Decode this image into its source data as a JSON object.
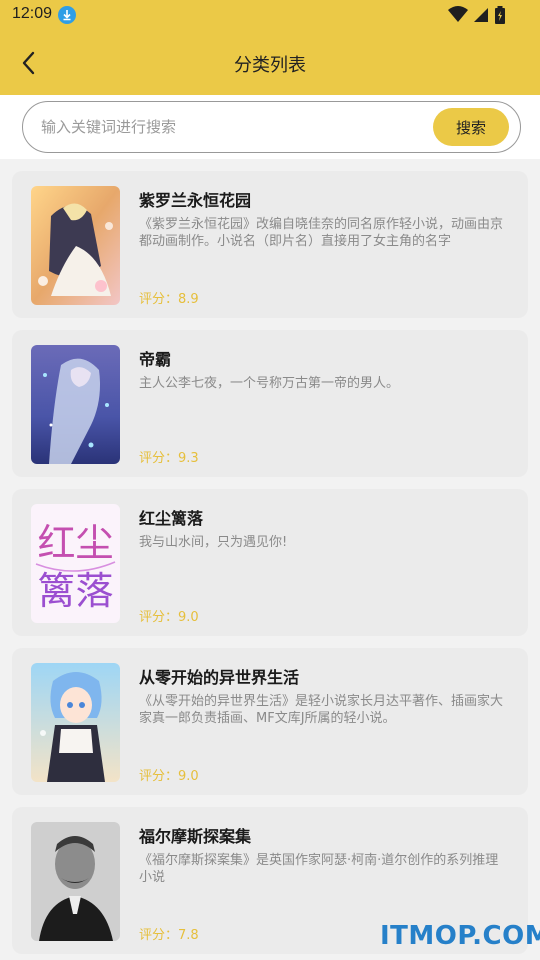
{
  "status_bar": {
    "time": "12:09",
    "icons": [
      "download-icon",
      "wifi-icon",
      "signal-icon",
      "battery-icon"
    ]
  },
  "header": {
    "back_icon": "chevron-left-icon",
    "title": "分类列表",
    "background": "#ebc947"
  },
  "search": {
    "placeholder": "输入关键词进行搜索",
    "value": "",
    "button_label": "搜索"
  },
  "books": [
    {
      "title": "紫罗兰永恒花园",
      "description": "《紫罗兰永恒花园》改编自晓佳奈的同名原作轻小说，动画由京都动画制作。小说名（即片名）直接用了女主角的名字",
      "rating": "评分：8.9",
      "cover": "violet-evergarden-cover"
    },
    {
      "title": "帝霸",
      "description": "主人公李七夜，一个号称万古第一帝的男人。",
      "rating": "评分：9.3",
      "cover": "dibba-cover"
    },
    {
      "title": "红尘篱落",
      "description": "我与山水间，只为遇见你!",
      "rating": "评分：9.0",
      "cover": "hongchen-liluo-cover",
      "cover_text": "红尘篱落"
    },
    {
      "title": "从零开始的异世界生活",
      "description": "《从零开始的异世界生活》是轻小说家长月达平著作、插画家大家真一郎负责插画、MF文库J所属的轻小说。",
      "rating": "评分：9.0",
      "cover": "re-zero-cover"
    },
    {
      "title": "福尔摩斯探案集",
      "description": "《福尔摩斯探案集》是英国作家阿瑟·柯南·道尔创作的系列推理小说",
      "rating": "评分：7.8",
      "cover": "sherlock-holmes-cover"
    }
  ],
  "watermark": "ITMOP.COM",
  "colors": {
    "accent": "#ebc947",
    "rating": "#e6bf3c",
    "card": "#ebebeb",
    "watermark": "#2680c9"
  }
}
